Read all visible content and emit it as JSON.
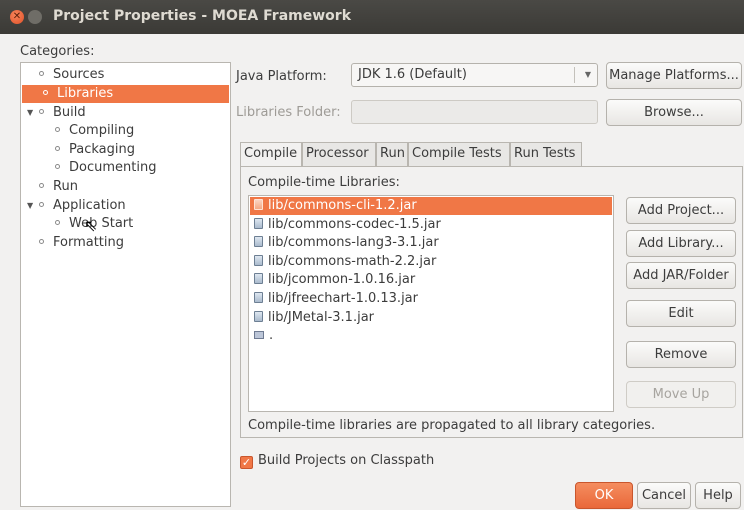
{
  "window": {
    "title": "Project Properties - MOEA Framework"
  },
  "categories": {
    "label": "Categories:",
    "items": [
      {
        "label": "Sources"
      },
      {
        "label": "Libraries"
      },
      {
        "label": "Build"
      },
      {
        "label": "Compiling"
      },
      {
        "label": "Packaging"
      },
      {
        "label": "Documenting"
      },
      {
        "label": "Run"
      },
      {
        "label": "Application"
      },
      {
        "label": "Web Start"
      },
      {
        "label": "Formatting"
      }
    ],
    "selected": "Libraries"
  },
  "platform": {
    "label": "Java Platform:",
    "value": "JDK 1.6 (Default)",
    "manage_button": "Manage Platforms..."
  },
  "libraries_folder": {
    "label": "Libraries Folder:",
    "browse_button": "Browse..."
  },
  "tabs": [
    "Compile",
    "Processor",
    "Run",
    "Compile Tests",
    "Run Tests"
  ],
  "active_tab": "Compile",
  "compile": {
    "list_label": "Compile-time Libraries:",
    "libraries": [
      "lib/commons-cli-1.2.jar",
      "lib/commons-codec-1.5.jar",
      "lib/commons-lang3-3.1.jar",
      "lib/commons-math-2.2.jar",
      "lib/jcommon-1.0.16.jar",
      "lib/jfreechart-1.0.13.jar",
      "lib/JMetal-3.1.jar",
      "."
    ],
    "selected_library": "lib/commons-cli-1.2.jar",
    "note": "Compile-time libraries are propagated to all library categories."
  },
  "side_buttons": {
    "add_project": "Add Project...",
    "add_library": "Add Library...",
    "add_jar": "Add JAR/Folder",
    "edit": "Edit",
    "remove": "Remove",
    "move_up": "Move Up"
  },
  "build_on_classpath": {
    "label": "Build Projects on Classpath",
    "checked": true
  },
  "footer": {
    "ok": "OK",
    "cancel": "Cancel",
    "help": "Help"
  },
  "colors": {
    "accent": "#f07746",
    "titlebar": "#3c3b37"
  }
}
